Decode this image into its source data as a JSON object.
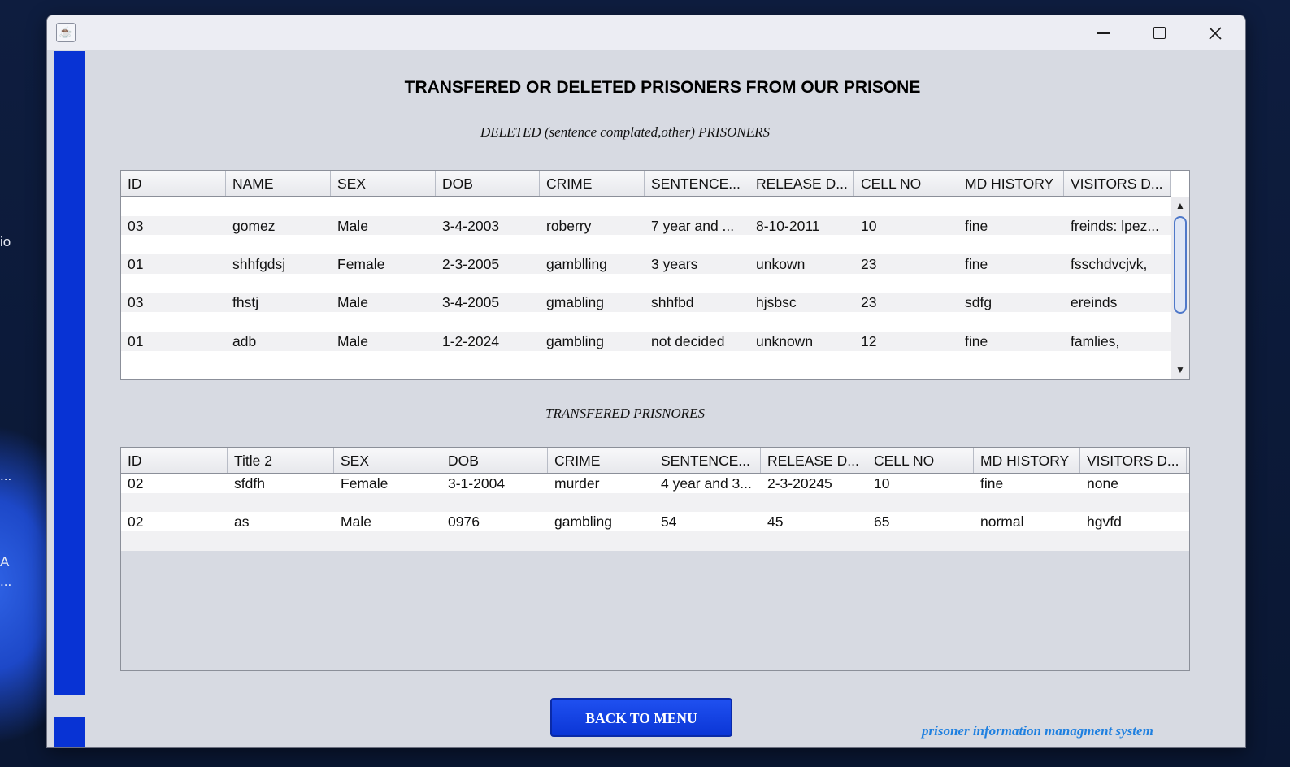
{
  "desktop": {
    "fragments": [
      "io",
      "...",
      "A",
      "..."
    ]
  },
  "window": {
    "icon_glyph": "☕"
  },
  "main_title": "TRANSFERED OR DELETED PRISONERS FROM OUR PRISONE",
  "deleted": {
    "caption": "DELETED (sentence complated,other) PRISONERS",
    "columns": [
      "ID",
      "NAME",
      "SEX",
      "DOB",
      "CRIME",
      "SENTENCE...",
      "RELEASE D...",
      "CELL NO",
      "MD HISTORY",
      "VISITORS D..."
    ],
    "rows": [
      [
        "03",
        "gomez",
        "Male",
        "3-4-2003",
        "roberry",
        "7 year and ...",
        "8-10-2011",
        "10",
        "fine",
        "freinds: lpez..."
      ],
      [
        "01",
        "shhfgdsj",
        "Female",
        "2-3-2005",
        "gamblling",
        "3 years",
        "unkown",
        "23",
        "fine",
        "fsschdvcjvk,"
      ],
      [
        "03",
        "fhstj",
        "Male",
        "3-4-2005",
        "gmabling",
        "shhfbd",
        "hjsbsc",
        "23",
        "sdfg",
        "ereinds"
      ],
      [
        "01",
        "adb",
        "Male",
        "1-2-2024",
        "gambling",
        "not decided",
        "unknown",
        "12",
        "fine",
        "famlies,"
      ]
    ]
  },
  "transferred": {
    "caption": "TRANSFERED PRISNORES",
    "columns": [
      "ID",
      "Title 2",
      "SEX",
      "DOB",
      "CRIME",
      "SENTENCE...",
      "RELEASE D...",
      "CELL NO",
      "MD HISTORY",
      "VISITORS D..."
    ],
    "rows": [
      [
        "02",
        "sfdfh",
        "Female",
        "3-1-2004",
        "murder",
        "4 year and 3...",
        "2-3-20245",
        "10",
        "fine",
        "none"
      ],
      [
        "02",
        "as",
        "Male",
        "0976",
        "gambling",
        "54",
        "45",
        "65",
        "normal",
        "hgvfd"
      ]
    ]
  },
  "back_button": "BACK TO MENU",
  "footer": "prisoner information managment system",
  "colors": {
    "sidebar_blue": "#0833d4",
    "button_blue": "#1f50f0",
    "footer_blue": "#1f80e0"
  }
}
